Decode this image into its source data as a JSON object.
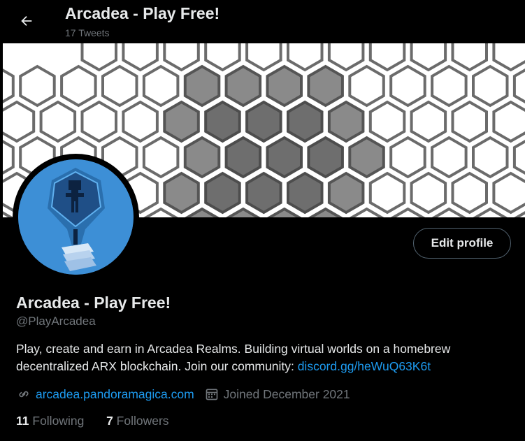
{
  "header": {
    "title": "Arcadea - Play Free!",
    "tweet_count": "17 Tweets"
  },
  "profile": {
    "name": "Arcadea - Play Free!",
    "handle": "@PlayArcadea",
    "bio_text": "Play, create and earn in Arcadea Realms. Building virtual worlds on a homebrew decentralized ARX blockchain. Join our community: ",
    "bio_link": "discord.gg/heWuQ63K6t",
    "website": "arcadea.pandoramagica.com",
    "joined": "Joined December 2021",
    "following_count": "11",
    "following_label": "Following",
    "followers_count": "7",
    "followers_label": "Followers",
    "edit_button": "Edit profile"
  },
  "icons": {
    "back": "arrow-left-icon",
    "website": "link-icon",
    "joined": "calendar-icon"
  },
  "colors": {
    "background": "#000000",
    "text": "#e7e9ea",
    "muted": "#71767b",
    "link": "#1d9bf0",
    "avatar_bg": "#3d8fd6"
  }
}
